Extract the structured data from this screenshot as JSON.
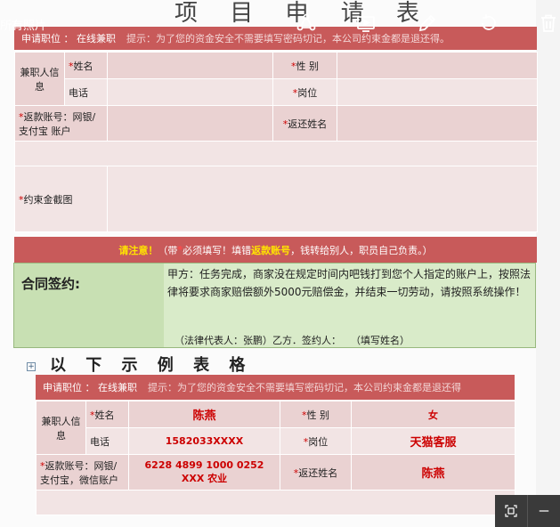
{
  "viewer": {
    "title": "所有照片"
  },
  "form": {
    "heading": "项 目 申 请 表",
    "header_bar": {
      "position": "申请职位 ： 在线兼职",
      "hint": "提示：为了您的资金安全不需要填写密码切记，本公司约束金都是退还得。"
    },
    "group_label": "兼职人信息",
    "name_label": "姓名",
    "gender_label": "性 别",
    "phone_label": "电话",
    "post_label": "岗位",
    "account_label": "返款账号：网银/支付宝 账户",
    "return_name_label": "返还姓名",
    "screenshot_label": "约束金截图",
    "required_mark": "*"
  },
  "notice": {
    "attention": "请注意！",
    "part1": "（带",
    "star": "*",
    "part2": "必须填写！填错",
    "highlight": "返款账号",
    "part3": "，钱转给别人，职员自己负责。）"
  },
  "contract": {
    "label": "合同签约:",
    "text": "甲方：任务完成，商家没在规定时间内吧钱打到您个人指定的账户上，按照法律将要求商家赔偿额外5000元赔偿金，并结束一切劳动，请按照系统操作！",
    "sign": "（法律代表人：张鹏）乙方．签约人：　　（填写姓名）"
  },
  "example": {
    "title": "以 下 示 例 表 格",
    "header_bar": {
      "position": "申请职位 ： 在线兼职",
      "hint": "提示：为了您的资金安全不需要填写密码切记，本公司约束金都是退还得"
    },
    "group_label": "兼职人信息",
    "name_label": "姓名",
    "name_value": "陈燕",
    "gender_label": "性 别",
    "gender_value": "女",
    "phone_label": "电话",
    "phone_value": "1582033XXXX",
    "post_label": "岗位",
    "post_value": "天猫客服",
    "account_label": "返款账号：网银/支付宝，微信账户",
    "account_value": "6228 4899 1000 0252 XXX 农业",
    "return_name_label": "返还姓名",
    "return_name_value": "陈燕"
  },
  "icons": {
    "toolbar": [
      "share-icon",
      "slideshow-icon",
      "edit-icon",
      "rotate-icon",
      "delete-icon"
    ],
    "bottom": [
      "fit-screen-icon",
      "zoom-out-icon"
    ]
  }
}
